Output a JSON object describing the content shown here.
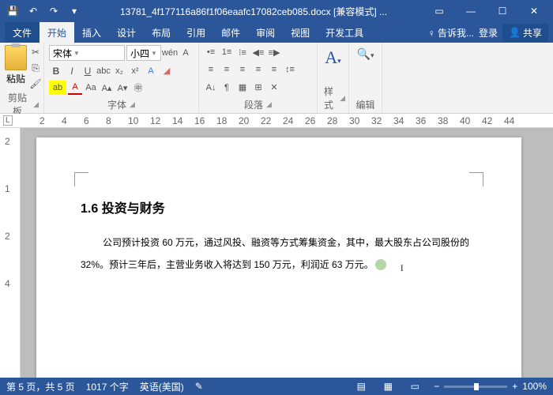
{
  "title": "13781_4f177116a86f1f06eaafc17082ceb085.docx [兼容模式] ...",
  "tabs": {
    "file": "文件",
    "home": "开始",
    "insert": "插入",
    "design": "设计",
    "layout": "布局",
    "references": "引用",
    "mail": "邮件",
    "review": "审阅",
    "view": "视图",
    "dev": "开发工具",
    "tellme": "告诉我...",
    "signin": "登录",
    "share": "共享"
  },
  "ribbon": {
    "clipboard": {
      "paste": "粘贴",
      "label": "剪贴板"
    },
    "font": {
      "name": "宋体",
      "size": "小四",
      "label": "字体"
    },
    "paragraph": {
      "label": "段落"
    },
    "styles": {
      "label": "样式"
    },
    "editing": {
      "label": "编辑"
    }
  },
  "ruler_ticks": [
    "2",
    "4",
    "6",
    "8",
    "10",
    "12",
    "14",
    "16",
    "18",
    "20",
    "22",
    "24",
    "26",
    "28",
    "30",
    "32",
    "34",
    "36",
    "38",
    "40",
    "42",
    "44"
  ],
  "vruler_ticks": [
    "2",
    "1",
    "2",
    "4"
  ],
  "document": {
    "heading": "1.6  投资与财务",
    "body": "公司预计投资 60 万元，通过风投、融资等方式筹集资金，其中，最大股东占公司股份的 32%。预计三年后，主营业务收入将达到 150 万元，利润近 63 万元。"
  },
  "status": {
    "page": "第 5 页，共 5 页",
    "words": "1017 个字",
    "lang": "英语(美国)",
    "zoom": "100%"
  }
}
